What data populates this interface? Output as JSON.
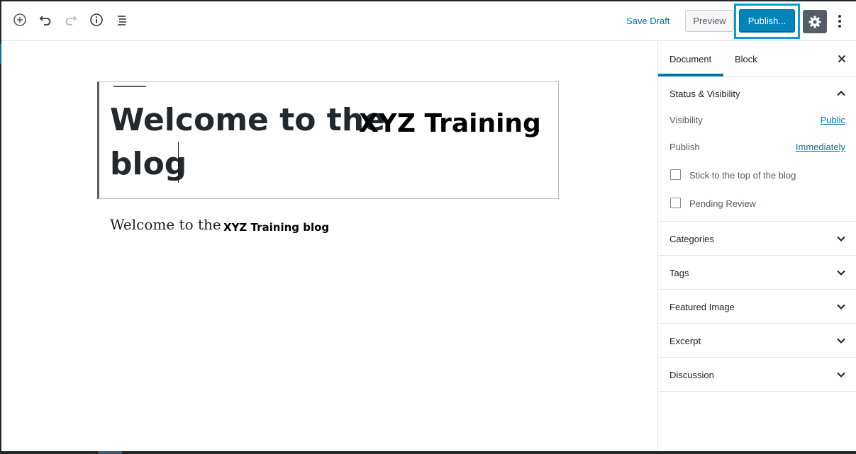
{
  "toolbar": {
    "save_draft": "Save Draft",
    "preview": "Preview",
    "publish": "Publish..."
  },
  "editor": {
    "title_part1": "Welcome to the",
    "title_part2": "XYZ Training",
    "title_part3": "blog",
    "para_serif": "Welcome to the",
    "para_bold": "XYZ Training blog"
  },
  "sidebar": {
    "tabs": [
      "Document",
      "Block"
    ],
    "status_panel": {
      "title": "Status & Visibility",
      "visibility_label": "Visibility",
      "visibility_value": "Public",
      "publish_label": "Publish",
      "publish_value": "Immediately",
      "sticky_label": "Stick to the top of the blog",
      "pending_label": "Pending Review"
    },
    "panels": [
      "Categories",
      "Tags",
      "Featured Image",
      "Excerpt",
      "Discussion"
    ]
  },
  "colors": {
    "accent": "#0085ba",
    "link": "#0073aa",
    "highlight_outline": "#00a0d2",
    "settings_bg": "#555d66"
  },
  "icons": {
    "add": "add-block-icon",
    "undo": "undo-icon",
    "redo": "redo-icon",
    "info": "info-icon",
    "outline": "block-navigation-icon",
    "settings": "gear-icon",
    "more": "more-vertical-icon",
    "close": "close-icon",
    "chevron": "chevron-icon"
  }
}
